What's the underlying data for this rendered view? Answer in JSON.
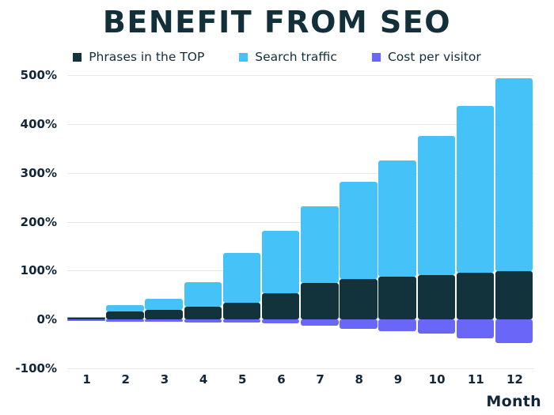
{
  "title": "BENEFIT FROM SEO",
  "legend": [
    {
      "label": "Phrases in the TOP",
      "color": "#12333C",
      "key": "phrases"
    },
    {
      "label": "Search traffic",
      "color": "#45C2F7",
      "key": "traffic"
    },
    {
      "label": "Cost per visitor",
      "color": "#6A66F7",
      "key": "cost"
    }
  ],
  "axis": {
    "x_title": "Month",
    "y_ticks": [
      "500%",
      "400%",
      "300%",
      "200%",
      "100%",
      "0%",
      "-100%"
    ],
    "x_ticks": [
      "1",
      "2",
      "3",
      "4",
      "5",
      "6",
      "7",
      "8",
      "9",
      "10",
      "11",
      "12"
    ]
  },
  "colors": {
    "phrases": "#12333C",
    "traffic": "#45C2F7",
    "cost": "#6A66F7",
    "grid": "#E6E8EC",
    "text": "#12263A",
    "title": "#122F3A",
    "background": "#FFFFFF"
  },
  "chart_data": {
    "type": "bar",
    "title": "BENEFIT FROM SEO",
    "subtitle": "",
    "xlabel": "Month",
    "ylabel": "",
    "stacked": true,
    "grid": true,
    "legend_position": "top",
    "ylim": [
      -100,
      500
    ],
    "yticks": [
      -100,
      0,
      100,
      200,
      300,
      400,
      500
    ],
    "ytick_labels": [
      "-100%",
      "0%",
      "100%",
      "200%",
      "300%",
      "400%",
      "500%"
    ],
    "categories": [
      "1",
      "2",
      "3",
      "4",
      "5",
      "6",
      "7",
      "8",
      "9",
      "10",
      "11",
      "12"
    ],
    "unit": "%",
    "series": [
      {
        "name": "Phrases in the TOP",
        "color": "#12333C",
        "values": [
          3,
          16,
          20,
          26,
          34,
          53,
          74,
          82,
          87,
          91,
          95,
          99
        ]
      },
      {
        "name": "Search traffic",
        "color": "#45C2F7",
        "values": [
          5,
          30,
          42,
          76,
          136,
          181,
          231,
          282,
          325,
          375,
          437,
          494
        ]
      },
      {
        "name": "Cost per visitor",
        "color": "#6A66F7",
        "values": [
          -3,
          -4,
          -5,
          -6,
          -7,
          -8,
          -13,
          -19,
          -24,
          -29,
          -39,
          -48
        ]
      }
    ]
  }
}
